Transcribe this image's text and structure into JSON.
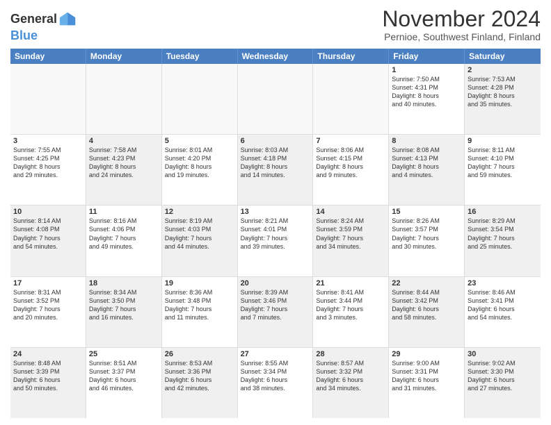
{
  "logo": {
    "line1": "General",
    "line2": "Blue"
  },
  "title": "November 2024",
  "subtitle": "Pernioe, Southwest Finland, Finland",
  "days": [
    "Sunday",
    "Monday",
    "Tuesday",
    "Wednesday",
    "Thursday",
    "Friday",
    "Saturday"
  ],
  "rows": [
    [
      {
        "day": "",
        "text": "",
        "empty": true
      },
      {
        "day": "",
        "text": "",
        "empty": true
      },
      {
        "day": "",
        "text": "",
        "empty": true
      },
      {
        "day": "",
        "text": "",
        "empty": true
      },
      {
        "day": "",
        "text": "",
        "empty": true
      },
      {
        "day": "1",
        "text": "Sunrise: 7:50 AM\nSunset: 4:31 PM\nDaylight: 8 hours\nand 40 minutes."
      },
      {
        "day": "2",
        "text": "Sunrise: 7:53 AM\nSunset: 4:28 PM\nDaylight: 8 hours\nand 35 minutes.",
        "shaded": true
      }
    ],
    [
      {
        "day": "3",
        "text": "Sunrise: 7:55 AM\nSunset: 4:25 PM\nDaylight: 8 hours\nand 29 minutes."
      },
      {
        "day": "4",
        "text": "Sunrise: 7:58 AM\nSunset: 4:23 PM\nDaylight: 8 hours\nand 24 minutes.",
        "shaded": true
      },
      {
        "day": "5",
        "text": "Sunrise: 8:01 AM\nSunset: 4:20 PM\nDaylight: 8 hours\nand 19 minutes."
      },
      {
        "day": "6",
        "text": "Sunrise: 8:03 AM\nSunset: 4:18 PM\nDaylight: 8 hours\nand 14 minutes.",
        "shaded": true
      },
      {
        "day": "7",
        "text": "Sunrise: 8:06 AM\nSunset: 4:15 PM\nDaylight: 8 hours\nand 9 minutes."
      },
      {
        "day": "8",
        "text": "Sunrise: 8:08 AM\nSunset: 4:13 PM\nDaylight: 8 hours\nand 4 minutes.",
        "shaded": true
      },
      {
        "day": "9",
        "text": "Sunrise: 8:11 AM\nSunset: 4:10 PM\nDaylight: 7 hours\nand 59 minutes."
      }
    ],
    [
      {
        "day": "10",
        "text": "Sunrise: 8:14 AM\nSunset: 4:08 PM\nDaylight: 7 hours\nand 54 minutes.",
        "shaded": true
      },
      {
        "day": "11",
        "text": "Sunrise: 8:16 AM\nSunset: 4:06 PM\nDaylight: 7 hours\nand 49 minutes."
      },
      {
        "day": "12",
        "text": "Sunrise: 8:19 AM\nSunset: 4:03 PM\nDaylight: 7 hours\nand 44 minutes.",
        "shaded": true
      },
      {
        "day": "13",
        "text": "Sunrise: 8:21 AM\nSunset: 4:01 PM\nDaylight: 7 hours\nand 39 minutes."
      },
      {
        "day": "14",
        "text": "Sunrise: 8:24 AM\nSunset: 3:59 PM\nDaylight: 7 hours\nand 34 minutes.",
        "shaded": true
      },
      {
        "day": "15",
        "text": "Sunrise: 8:26 AM\nSunset: 3:57 PM\nDaylight: 7 hours\nand 30 minutes."
      },
      {
        "day": "16",
        "text": "Sunrise: 8:29 AM\nSunset: 3:54 PM\nDaylight: 7 hours\nand 25 minutes.",
        "shaded": true
      }
    ],
    [
      {
        "day": "17",
        "text": "Sunrise: 8:31 AM\nSunset: 3:52 PM\nDaylight: 7 hours\nand 20 minutes."
      },
      {
        "day": "18",
        "text": "Sunrise: 8:34 AM\nSunset: 3:50 PM\nDaylight: 7 hours\nand 16 minutes.",
        "shaded": true
      },
      {
        "day": "19",
        "text": "Sunrise: 8:36 AM\nSunset: 3:48 PM\nDaylight: 7 hours\nand 11 minutes."
      },
      {
        "day": "20",
        "text": "Sunrise: 8:39 AM\nSunset: 3:46 PM\nDaylight: 7 hours\nand 7 minutes.",
        "shaded": true
      },
      {
        "day": "21",
        "text": "Sunrise: 8:41 AM\nSunset: 3:44 PM\nDaylight: 7 hours\nand 3 minutes."
      },
      {
        "day": "22",
        "text": "Sunrise: 8:44 AM\nSunset: 3:42 PM\nDaylight: 6 hours\nand 58 minutes.",
        "shaded": true
      },
      {
        "day": "23",
        "text": "Sunrise: 8:46 AM\nSunset: 3:41 PM\nDaylight: 6 hours\nand 54 minutes."
      }
    ],
    [
      {
        "day": "24",
        "text": "Sunrise: 8:48 AM\nSunset: 3:39 PM\nDaylight: 6 hours\nand 50 minutes.",
        "shaded": true
      },
      {
        "day": "25",
        "text": "Sunrise: 8:51 AM\nSunset: 3:37 PM\nDaylight: 6 hours\nand 46 minutes."
      },
      {
        "day": "26",
        "text": "Sunrise: 8:53 AM\nSunset: 3:36 PM\nDaylight: 6 hours\nand 42 minutes.",
        "shaded": true
      },
      {
        "day": "27",
        "text": "Sunrise: 8:55 AM\nSunset: 3:34 PM\nDaylight: 6 hours\nand 38 minutes."
      },
      {
        "day": "28",
        "text": "Sunrise: 8:57 AM\nSunset: 3:32 PM\nDaylight: 6 hours\nand 34 minutes.",
        "shaded": true
      },
      {
        "day": "29",
        "text": "Sunrise: 9:00 AM\nSunset: 3:31 PM\nDaylight: 6 hours\nand 31 minutes."
      },
      {
        "day": "30",
        "text": "Sunrise: 9:02 AM\nSunset: 3:30 PM\nDaylight: 6 hours\nand 27 minutes.",
        "shaded": true
      }
    ]
  ]
}
